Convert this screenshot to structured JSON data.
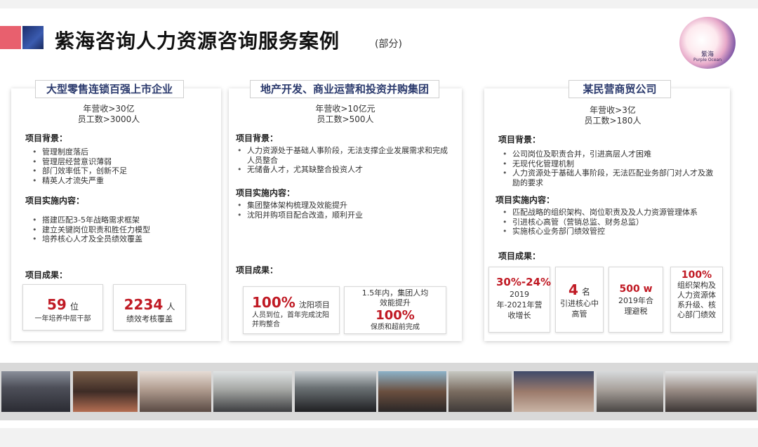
{
  "header": {
    "title": "紫海咨询人力资源咨询服务案例",
    "subtitle": "(部分)",
    "logo_cn": "紫海",
    "logo_en": "Purple Ocean"
  },
  "cases": [
    {
      "name": "大型零售连锁百强上市企业",
      "info": [
        "年营收>30亿",
        "员工数>3000人"
      ],
      "background_title": "项目背景：",
      "background": [
        "管理制度落后",
        "管理层经营意识薄弱",
        "部门效率低下，创新不足",
        "精英人才流失严重"
      ],
      "impl_title": "项目实施内容：",
      "impl": [
        "搭建匹配3-5年战略需求框架",
        "建立关键岗位职责和胜任力模型",
        "培养核心人才及全员绩效覆盖"
      ],
      "result_title": "项目成果：",
      "results": [
        {
          "num": "59",
          "unit": "位",
          "desc": "一年培养中层干部"
        },
        {
          "num": "2234",
          "unit": "人",
          "desc": "绩效考核覆盖"
        }
      ]
    },
    {
      "name": "地产开发、商业运营和投资并购集团",
      "info": [
        "年营收>10亿元",
        "员工数>500人"
      ],
      "background_title": "项目背景：",
      "background": [
        "人力资源处于基础人事阶段，无法支撑企业发展需求和完成人员整合",
        "无储备人才，尤其缺整合投资人才"
      ],
      "impl_title": "项目实施内容：",
      "impl": [
        "集团整体架构梳理及效能提升",
        "沈阳并购项目配合改造，顺利开业"
      ],
      "result_title": "项目成果：",
      "results": [
        {
          "num": "100%",
          "label": "沈阳项目",
          "desc": "人员到位，首年完成沈阳并购整合"
        },
        {
          "pre": "1.5年内，集团人均效能提升",
          "num": "100%",
          "desc": "保质和超前完成"
        }
      ]
    },
    {
      "name": "某民营商贸公司",
      "info": [
        "年营收>3亿",
        "员工数>180人"
      ],
      "background_title": "项目背景：",
      "background": [
        "公司岗位及职责合并，引进高层人才困难",
        "无现代化管理机制",
        "人力资源处于基础人事阶段，无法匹配业务部门对人才及激励的要求"
      ],
      "impl_title": "项目实施内容：",
      "impl": [
        "匹配战略的组织架构、岗位职责及及人力资源管理体系",
        "引进核心高管（营销总监、财务总监）",
        "实施核心业务部门绩效管控"
      ],
      "result_title": "项目成果：",
      "results": [
        {
          "num": "30%-24%",
          "desc": "2019年-2021年营收增长"
        },
        {
          "num": "4",
          "unit": "名",
          "desc": "引进核心中高管"
        },
        {
          "num": "500 w",
          "desc": "2019年合理避税"
        },
        {
          "num": "100%",
          "desc": "组织架构及人力资源体系升级、核心部门绩效"
        }
      ]
    }
  ],
  "photos": [
    "photo-team-1",
    "photo-team-2",
    "photo-training-1",
    "photo-training-2",
    "photo-workshop-1",
    "photo-workshop-2",
    "photo-group-1",
    "photo-meeting-1",
    "photo-meeting-2",
    "photo-event-1"
  ]
}
